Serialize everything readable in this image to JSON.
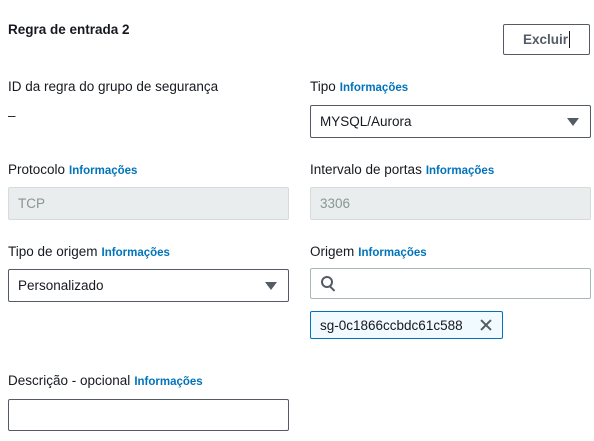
{
  "rule": {
    "title": "Regra de entrada 2",
    "delete_label": "Excluir"
  },
  "info_label": "Informações",
  "fields": {
    "rule_id": {
      "label": "ID da regra do grupo de segurança",
      "value": "–"
    },
    "type": {
      "label": "Tipo",
      "value": "MYSQL/Aurora"
    },
    "protocol": {
      "label": "Protocolo",
      "value": "TCP"
    },
    "port_range": {
      "label": "Intervalo de portas",
      "value": "3306"
    },
    "source_type": {
      "label": "Tipo de origem",
      "value": "Personalizado"
    },
    "source": {
      "label": "Origem",
      "value": "",
      "token": "sg-0c1866ccbdc61c588"
    },
    "description": {
      "label": "Descrição - opcional",
      "value": ""
    }
  }
}
